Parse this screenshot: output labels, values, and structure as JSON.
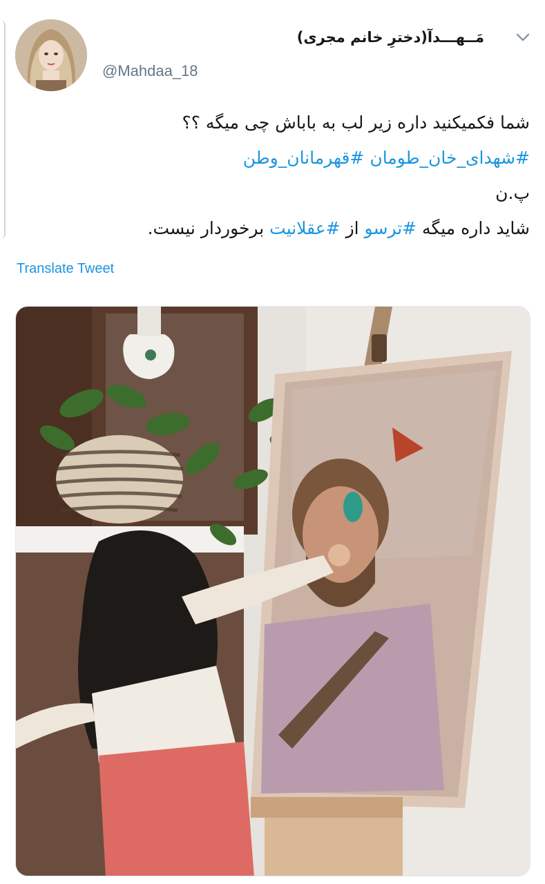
{
  "tweet": {
    "author": {
      "display_name": "مَــهـــدآ(دخترِ خانم مجری)",
      "handle": "@Mahdaa_18",
      "avatar_icon": "avatar-doll-photo"
    },
    "more_icon": "chevron-down-icon",
    "body": {
      "line1": "شما فکمیکنید داره زیر لب به باباش چی میگه ؟؟",
      "hashtag1": "#شهدای_خان_طومان",
      "hashtag2": "#قهرمانان_وطن",
      "line3": "پ.ن",
      "line4_part1": "شاید داره میگه ",
      "hashtag3": "#ترسو",
      "line4_part2": " از ",
      "hashtag4": "#عقلانیت",
      "line4_part3": " برخوردار نیست."
    },
    "translate_label": "Translate Tweet",
    "media": {
      "description_icon": "photo-girl-combing-portrait"
    }
  },
  "colors": {
    "link": "#1b95e0",
    "text": "#14171a",
    "secondary": "#657786"
  }
}
